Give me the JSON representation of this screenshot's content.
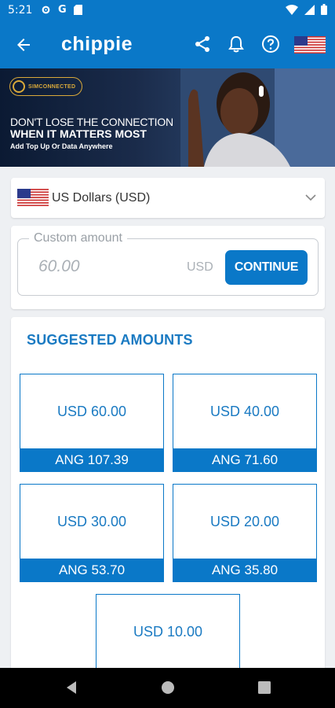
{
  "status_bar": {
    "time": "5:21",
    "notif_g": "G"
  },
  "app_bar": {
    "brand": "chippie",
    "icons": [
      "back-arrow-icon",
      "share-icon",
      "bell-icon",
      "help-icon",
      "us-flag-icon"
    ]
  },
  "banner": {
    "logo_text": "SIMCONNECTED",
    "line1": "DON'T LOSE THE CONNECTION",
    "line2": "WHEN IT MATTERS MOST",
    "line3": "Add Top Up Or Data Anywhere"
  },
  "currency_select": {
    "label": "US Dollars (USD)"
  },
  "custom_amount": {
    "legend": "Custom amount",
    "placeholder": "60.00",
    "currency": "USD",
    "button": "CONTINUE"
  },
  "suggested": {
    "title": "SUGGESTED AMOUNTS",
    "items": [
      {
        "usd": "USD 60.00",
        "ang": "ANG 107.39"
      },
      {
        "usd": "USD 40.00",
        "ang": "ANG 71.60"
      },
      {
        "usd": "USD 30.00",
        "ang": "ANG 53.70"
      },
      {
        "usd": "USD 20.00",
        "ang": "ANG 35.80"
      },
      {
        "usd": "USD 10.00",
        "ang": ""
      }
    ]
  },
  "colors": {
    "primary": "#0a78c8",
    "background": "#eef0f3",
    "nav": "#000000"
  }
}
